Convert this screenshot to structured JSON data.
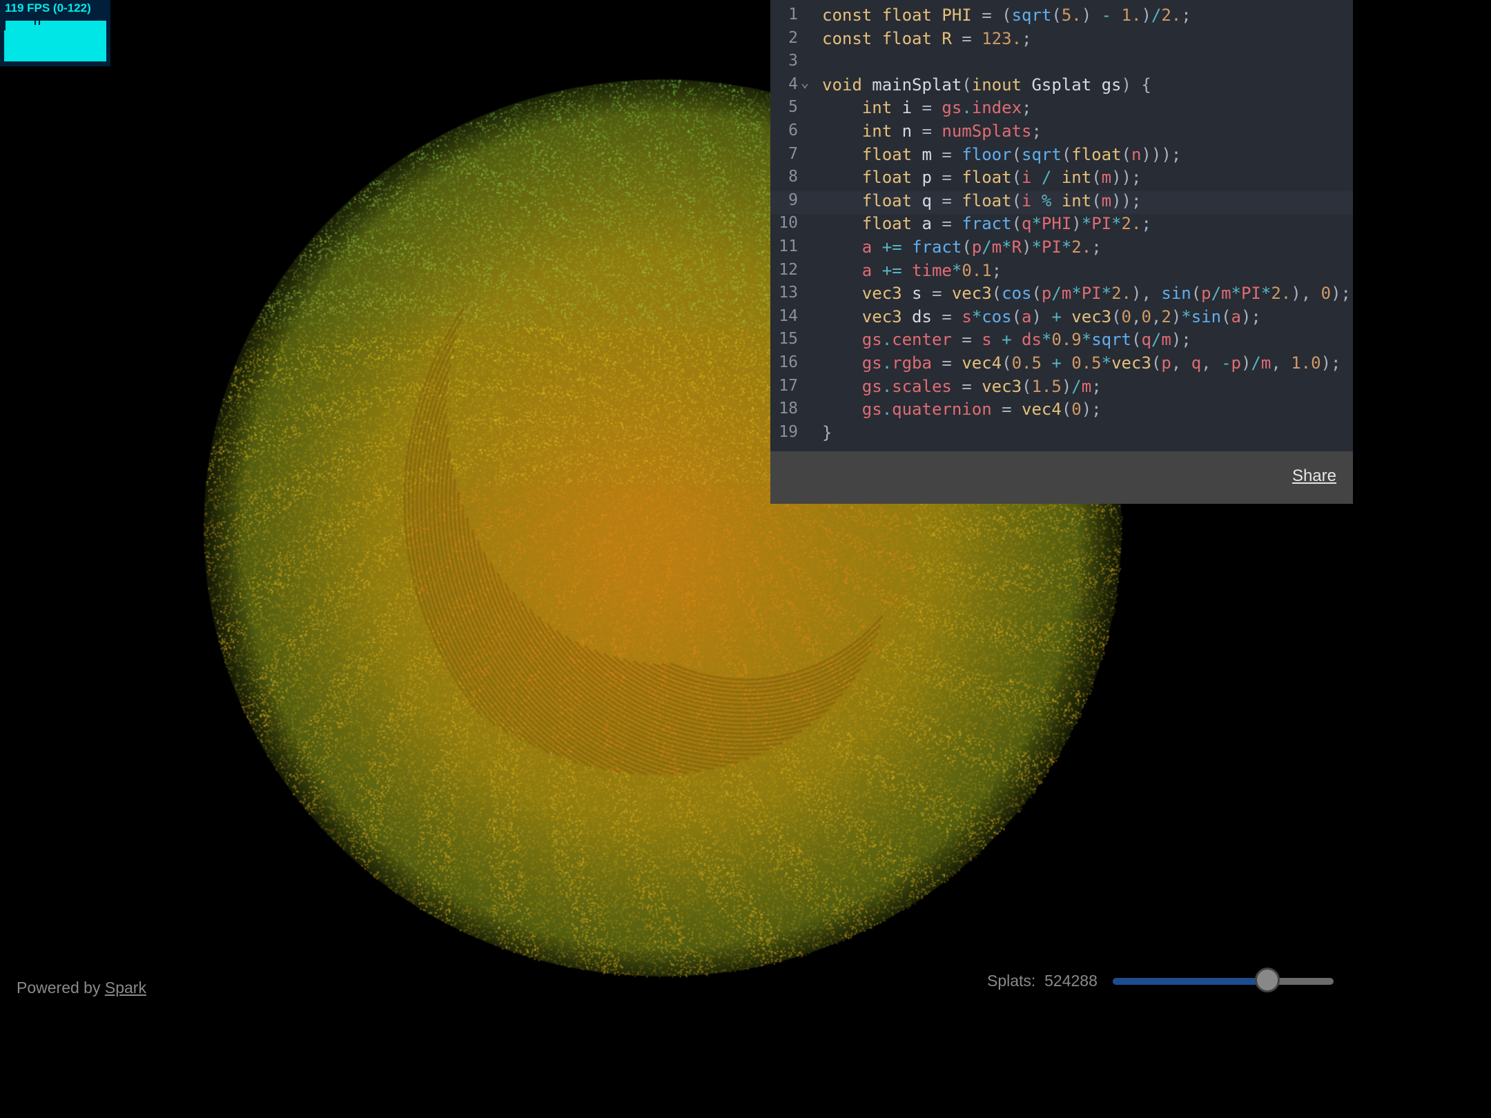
{
  "fps": {
    "text": "119 FPS (0-122)"
  },
  "editor": {
    "active_line": 9,
    "lines": [
      [
        [
          "kw",
          "const "
        ],
        [
          "kw",
          "float "
        ],
        [
          "kw",
          "PHI"
        ],
        [
          "pun",
          " = ("
        ],
        [
          "fn",
          "sqrt"
        ],
        [
          "pun",
          "("
        ],
        [
          "num",
          "5."
        ],
        [
          "pun",
          ") "
        ],
        [
          "op",
          "-"
        ],
        [
          "pun",
          " "
        ],
        [
          "num",
          "1."
        ],
        [
          "pun",
          ")"
        ],
        [
          "op",
          "/"
        ],
        [
          "num",
          "2."
        ],
        [
          "pun",
          ";"
        ]
      ],
      [
        [
          "kw",
          "const "
        ],
        [
          "kw",
          "float "
        ],
        [
          "kw",
          "R"
        ],
        [
          "pun",
          " = "
        ],
        [
          "num",
          "123."
        ],
        [
          "pun",
          ";"
        ]
      ],
      [],
      [
        [
          "kw",
          "void "
        ],
        [
          "idn",
          "mainSplat"
        ],
        [
          "pun",
          "("
        ],
        [
          "kw",
          "inout "
        ],
        [
          "idn",
          "Gsplat gs"
        ],
        [
          "pun",
          ") {"
        ]
      ],
      [
        [
          "pun",
          "    "
        ],
        [
          "kw",
          "int "
        ],
        [
          "idn",
          "i"
        ],
        [
          "pun",
          " = "
        ],
        [
          "var",
          "gs"
        ],
        [
          "op",
          "."
        ],
        [
          "var",
          "index"
        ],
        [
          "pun",
          ";"
        ]
      ],
      [
        [
          "pun",
          "    "
        ],
        [
          "kw",
          "int "
        ],
        [
          "idn",
          "n"
        ],
        [
          "pun",
          " = "
        ],
        [
          "var",
          "numSplats"
        ],
        [
          "pun",
          ";"
        ]
      ],
      [
        [
          "pun",
          "    "
        ],
        [
          "kw",
          "float "
        ],
        [
          "idn",
          "m"
        ],
        [
          "pun",
          " = "
        ],
        [
          "fn",
          "floor"
        ],
        [
          "pun",
          "("
        ],
        [
          "fn",
          "sqrt"
        ],
        [
          "pun",
          "("
        ],
        [
          "kw",
          "float"
        ],
        [
          "pun",
          "("
        ],
        [
          "var",
          "n"
        ],
        [
          "pun",
          ")));"
        ]
      ],
      [
        [
          "pun",
          "    "
        ],
        [
          "kw",
          "float "
        ],
        [
          "idn",
          "p"
        ],
        [
          "pun",
          " = "
        ],
        [
          "kw",
          "float"
        ],
        [
          "pun",
          "("
        ],
        [
          "var",
          "i"
        ],
        [
          "pun",
          " "
        ],
        [
          "op",
          "/"
        ],
        [
          "pun",
          " "
        ],
        [
          "kw",
          "int"
        ],
        [
          "pun",
          "("
        ],
        [
          "var",
          "m"
        ],
        [
          "pun",
          "));"
        ]
      ],
      [
        [
          "pun",
          "    "
        ],
        [
          "kw",
          "float "
        ],
        [
          "idn",
          "q"
        ],
        [
          "pun",
          " = "
        ],
        [
          "kw",
          "float"
        ],
        [
          "pun",
          "("
        ],
        [
          "var",
          "i"
        ],
        [
          "pun",
          " "
        ],
        [
          "op",
          "%"
        ],
        [
          "pun",
          " "
        ],
        [
          "kw",
          "int"
        ],
        [
          "pun",
          "("
        ],
        [
          "var",
          "m"
        ],
        [
          "pun",
          "));"
        ]
      ],
      [
        [
          "pun",
          "    "
        ],
        [
          "kw",
          "float "
        ],
        [
          "idn",
          "a"
        ],
        [
          "pun",
          " = "
        ],
        [
          "fn",
          "fract"
        ],
        [
          "pun",
          "("
        ],
        [
          "var",
          "q"
        ],
        [
          "op",
          "*"
        ],
        [
          "var",
          "PHI"
        ],
        [
          "pun",
          ")"
        ],
        [
          "op",
          "*"
        ],
        [
          "var",
          "PI"
        ],
        [
          "op",
          "*"
        ],
        [
          "num",
          "2."
        ],
        [
          "pun",
          ";"
        ]
      ],
      [
        [
          "pun",
          "    "
        ],
        [
          "var",
          "a"
        ],
        [
          "pun",
          " "
        ],
        [
          "op",
          "+="
        ],
        [
          "pun",
          " "
        ],
        [
          "fn",
          "fract"
        ],
        [
          "pun",
          "("
        ],
        [
          "var",
          "p"
        ],
        [
          "op",
          "/"
        ],
        [
          "var",
          "m"
        ],
        [
          "op",
          "*"
        ],
        [
          "var",
          "R"
        ],
        [
          "pun",
          ")"
        ],
        [
          "op",
          "*"
        ],
        [
          "var",
          "PI"
        ],
        [
          "op",
          "*"
        ],
        [
          "num",
          "2."
        ],
        [
          "pun",
          ";"
        ]
      ],
      [
        [
          "pun",
          "    "
        ],
        [
          "var",
          "a"
        ],
        [
          "pun",
          " "
        ],
        [
          "op",
          "+="
        ],
        [
          "pun",
          " "
        ],
        [
          "var",
          "time"
        ],
        [
          "op",
          "*"
        ],
        [
          "num",
          "0.1"
        ],
        [
          "pun",
          ";"
        ]
      ],
      [
        [
          "pun",
          "    "
        ],
        [
          "kw",
          "vec3 "
        ],
        [
          "idn",
          "s"
        ],
        [
          "pun",
          " = "
        ],
        [
          "kw",
          "vec3"
        ],
        [
          "pun",
          "("
        ],
        [
          "fn",
          "cos"
        ],
        [
          "pun",
          "("
        ],
        [
          "var",
          "p"
        ],
        [
          "op",
          "/"
        ],
        [
          "var",
          "m"
        ],
        [
          "op",
          "*"
        ],
        [
          "var",
          "PI"
        ],
        [
          "op",
          "*"
        ],
        [
          "num",
          "2."
        ],
        [
          "pun",
          "), "
        ],
        [
          "fn",
          "sin"
        ],
        [
          "pun",
          "("
        ],
        [
          "var",
          "p"
        ],
        [
          "op",
          "/"
        ],
        [
          "var",
          "m"
        ],
        [
          "op",
          "*"
        ],
        [
          "var",
          "PI"
        ],
        [
          "op",
          "*"
        ],
        [
          "num",
          "2."
        ],
        [
          "pun",
          "), "
        ],
        [
          "num",
          "0"
        ],
        [
          "pun",
          ");"
        ]
      ],
      [
        [
          "pun",
          "    "
        ],
        [
          "kw",
          "vec3 "
        ],
        [
          "idn",
          "ds"
        ],
        [
          "pun",
          " = "
        ],
        [
          "var",
          "s"
        ],
        [
          "op",
          "*"
        ],
        [
          "fn",
          "cos"
        ],
        [
          "pun",
          "("
        ],
        [
          "var",
          "a"
        ],
        [
          "pun",
          ") "
        ],
        [
          "op",
          "+"
        ],
        [
          "pun",
          " "
        ],
        [
          "kw",
          "vec3"
        ],
        [
          "pun",
          "("
        ],
        [
          "num",
          "0"
        ],
        [
          "pun",
          ","
        ],
        [
          "num",
          "0"
        ],
        [
          "pun",
          ","
        ],
        [
          "num",
          "2"
        ],
        [
          "pun",
          ")"
        ],
        [
          "op",
          "*"
        ],
        [
          "fn",
          "sin"
        ],
        [
          "pun",
          "("
        ],
        [
          "var",
          "a"
        ],
        [
          "pun",
          ");"
        ]
      ],
      [
        [
          "pun",
          "    "
        ],
        [
          "var",
          "gs"
        ],
        [
          "op",
          "."
        ],
        [
          "var",
          "center"
        ],
        [
          "pun",
          " = "
        ],
        [
          "var",
          "s"
        ],
        [
          "pun",
          " "
        ],
        [
          "op",
          "+"
        ],
        [
          "pun",
          " "
        ],
        [
          "var",
          "ds"
        ],
        [
          "op",
          "*"
        ],
        [
          "num",
          "0.9"
        ],
        [
          "op",
          "*"
        ],
        [
          "fn",
          "sqrt"
        ],
        [
          "pun",
          "("
        ],
        [
          "var",
          "q"
        ],
        [
          "op",
          "/"
        ],
        [
          "var",
          "m"
        ],
        [
          "pun",
          ");"
        ]
      ],
      [
        [
          "pun",
          "    "
        ],
        [
          "var",
          "gs"
        ],
        [
          "op",
          "."
        ],
        [
          "var",
          "rgba"
        ],
        [
          "pun",
          " = "
        ],
        [
          "kw",
          "vec4"
        ],
        [
          "pun",
          "("
        ],
        [
          "num",
          "0.5"
        ],
        [
          "pun",
          " "
        ],
        [
          "op",
          "+"
        ],
        [
          "pun",
          " "
        ],
        [
          "num",
          "0.5"
        ],
        [
          "op",
          "*"
        ],
        [
          "kw",
          "vec3"
        ],
        [
          "pun",
          "("
        ],
        [
          "var",
          "p"
        ],
        [
          "pun",
          ", "
        ],
        [
          "var",
          "q"
        ],
        [
          "pun",
          ", "
        ],
        [
          "op",
          "-"
        ],
        [
          "var",
          "p"
        ],
        [
          "pun",
          ")"
        ],
        [
          "op",
          "/"
        ],
        [
          "var",
          "m"
        ],
        [
          "pun",
          ", "
        ],
        [
          "num",
          "1.0"
        ],
        [
          "pun",
          ");"
        ]
      ],
      [
        [
          "pun",
          "    "
        ],
        [
          "var",
          "gs"
        ],
        [
          "op",
          "."
        ],
        [
          "var",
          "scales"
        ],
        [
          "pun",
          " = "
        ],
        [
          "kw",
          "vec3"
        ],
        [
          "pun",
          "("
        ],
        [
          "num",
          "1.5"
        ],
        [
          "pun",
          ")"
        ],
        [
          "op",
          "/"
        ],
        [
          "var",
          "m"
        ],
        [
          "pun",
          ";"
        ]
      ],
      [
        [
          "pun",
          "    "
        ],
        [
          "var",
          "gs"
        ],
        [
          "op",
          "."
        ],
        [
          "var",
          "quaternion"
        ],
        [
          "pun",
          " = "
        ],
        [
          "kw",
          "vec4"
        ],
        [
          "pun",
          "("
        ],
        [
          "num",
          "0"
        ],
        [
          "pun",
          ");"
        ]
      ],
      [
        [
          "pun",
          "}"
        ]
      ]
    ],
    "share_label": "Share"
  },
  "footer": {
    "powered_prefix": "Powered by ",
    "powered_link": "Spark",
    "splats_label": "Splats:",
    "splats_value": "524288",
    "slider_fraction": 0.7
  },
  "colors": {
    "background": "#000000",
    "fps_accent": "#00ecec",
    "editor_bg": "#282c34",
    "slider_fill": "#1e4d8f"
  }
}
